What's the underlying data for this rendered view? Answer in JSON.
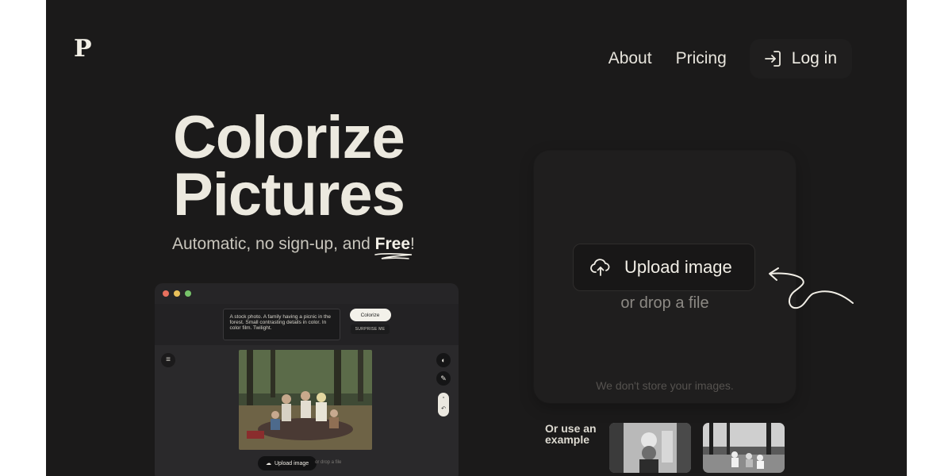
{
  "brand": {
    "logo": "P"
  },
  "nav": {
    "about": "About",
    "pricing": "Pricing",
    "login": "Log in"
  },
  "hero": {
    "line1": "Colorize",
    "line2": "Pictures",
    "subtitle_prefix": "Automatic, no sign-up, and",
    "subtitle_free": "Free",
    "subtitle_suffix": "!"
  },
  "mockup": {
    "prompt": "A stock photo. A family having a picnic in the forest. Small contrasting details in color. In color film. Twilight.",
    "colorize_label": "Colorize",
    "surprise_label": "SURPRISE ME",
    "upload_label": "Upload image",
    "drop_label": "or drop a file",
    "dot_colors": [
      "#e8705e",
      "#e9c05a",
      "#77c36a"
    ]
  },
  "upload": {
    "button_label": "Upload image",
    "drop_text": "or drop a file",
    "privacy_note": "We don't store your images."
  },
  "examples": {
    "label_line1": "Or use an",
    "label_line2": "example"
  },
  "icons": [
    "login-icon",
    "cloud-upload-icon",
    "menu-icon",
    "palette-icon",
    "pencil-icon",
    "undo-icon",
    "arrow-doodle-icon"
  ],
  "colors": {
    "background": "#1b1a1a",
    "card": "#1f1e1e",
    "text": "#ece9df",
    "muted": "#8c8984"
  }
}
